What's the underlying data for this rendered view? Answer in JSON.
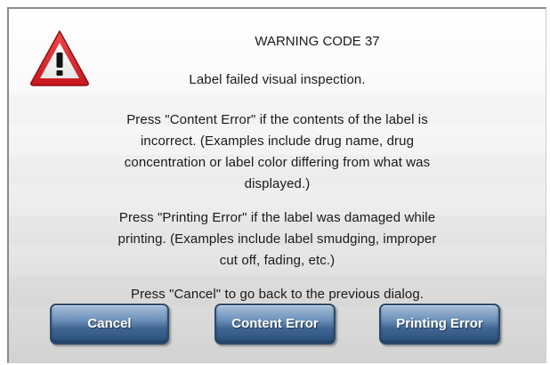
{
  "dialog": {
    "title": "WARNING CODE 37",
    "icon": "warning-triangle-icon",
    "message_1": "Label failed visual inspection.",
    "message_2_lines": [
      "Press \"Content Error\" if the contents of the label is",
      "incorrect. (Examples include drug name, drug",
      "concentration or label color differing from what was",
      "displayed.)"
    ],
    "message_3_lines": [
      "Press \"Printing Error\" if the label was damaged while",
      "printing. (Examples include label smudging, improper",
      "cut off, fading, etc.)"
    ],
    "message_4": "Press \"Cancel\" to go back to the previous dialog."
  },
  "buttons": {
    "cancel": "Cancel",
    "content_error": "Content Error",
    "printing_error": "Printing Error"
  },
  "colors": {
    "warning_red": "#d8232a",
    "button_blue": "#3f6592"
  }
}
